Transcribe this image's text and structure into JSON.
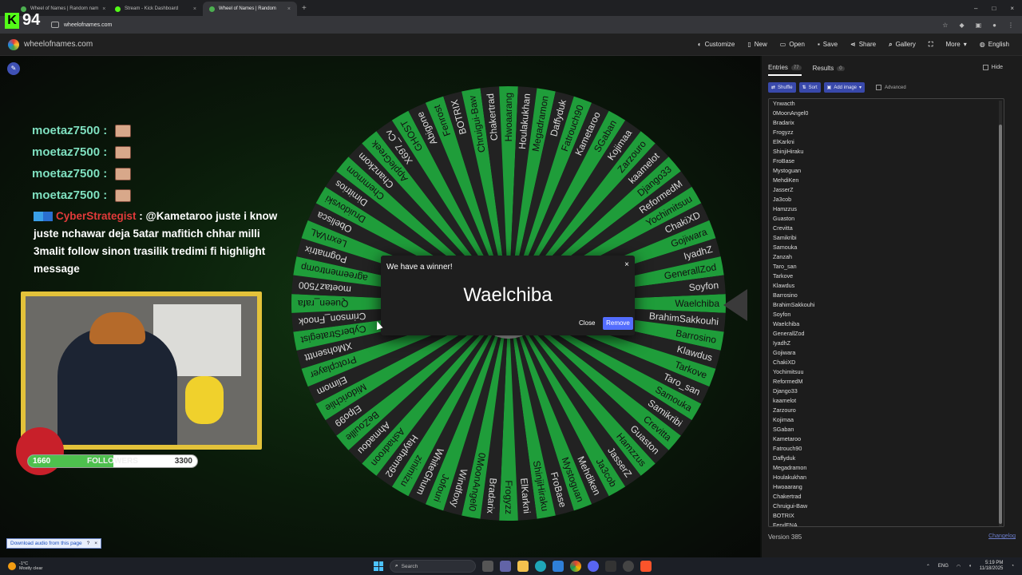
{
  "browser": {
    "tabs": [
      {
        "title": "Wheel of Names | Random nam",
        "color": "#4caf50",
        "active": false
      },
      {
        "title": "Stream - Kick Dashboard",
        "color": "#53fc18",
        "active": false
      },
      {
        "title": "Wheel of Names | Random",
        "color": "#4caf50",
        "active": true
      }
    ],
    "url": "wheelofnames.com"
  },
  "kick": {
    "logo": "K",
    "count": "94"
  },
  "app": {
    "site_name": "wheelofnames.com",
    "menu": [
      {
        "label": "Customize",
        "icon": "palette-icon"
      },
      {
        "label": "New",
        "icon": "file-icon"
      },
      {
        "label": "Open",
        "icon": "folder-icon"
      },
      {
        "label": "Save",
        "icon": "save-icon"
      },
      {
        "label": "Share",
        "icon": "share-icon"
      },
      {
        "label": "Gallery",
        "icon": "search-icon"
      },
      {
        "label": "",
        "icon": "fullscreen-icon"
      },
      {
        "label": "More",
        "icon": "chevron-down-icon"
      },
      {
        "label": "English",
        "icon": "globe-icon"
      }
    ]
  },
  "overlay": {
    "chat_lines": [
      "moetaz7500 :",
      "moetaz7500 :",
      "moetaz7500 :",
      "moetaz7500 :"
    ],
    "message_user": "CyberStrategist",
    "message_text": " : @Kametaroo juste i know juste nchawar deja 5atar mafitich chhar milli 3malit follow sinon trasilik tredimi fi highlight message",
    "followers": {
      "current": "1660",
      "label": "FOLLOWERS",
      "goal": "3300",
      "progress": 0.503
    }
  },
  "download_bar": {
    "label": "Download audio from this page",
    "help": "?",
    "close": "×"
  },
  "wheel": {
    "colors": [
      "#1f9d3a",
      "#222222"
    ],
    "names": [
      "Waelchiba",
      "BrahimSakkouhi",
      "Barrosino",
      "Klawdus",
      "Tarkove",
      "Taro_san",
      "Samouka",
      "Samikribi",
      "Crevitta",
      "Guaston",
      "Hamzzus",
      "JasserZ",
      "Ja3cob",
      "Mehdiken",
      "Mystoguan",
      "FroBase",
      "ShinjiHiraku",
      "ElKarkni",
      "Frogyzz",
      "Bradarix",
      "0MoonAngel0",
      "Windfoxy",
      "Jofouri",
      "WhiteGhum",
      "zinimizu",
      "Haythem92",
      "Ashadroon",
      "Ahmadou",
      "BeZouille",
      "Elpo99",
      "Midorichlie",
      "Elimom",
      "Protcplayer",
      "XMohsenttt",
      "CyberStrategist",
      "Crimson_Fnook",
      "Queen_rafa",
      "moetaz7500",
      "agreementromp",
      "Pogmatrix",
      "LexnVAL",
      "Obelisca",
      "Druidovski",
      "Dimitrios",
      "Chemmom",
      "Chanzkom",
      "AppleGreek",
      "X697_Cv",
      "GHOST",
      "Abigone",
      "Fenrost",
      "BOTRIX",
      "Chruigui-Baw",
      "Chakertrad",
      "Hwoaarang",
      "Houlakukhan",
      "Megadramon",
      "Daffyduk",
      "Fatrouch90",
      "Kametaroo",
      "SGaban",
      "Kojimaa",
      "Zarzouro",
      "kaamelot",
      "Django33",
      "ReformedM",
      "Yochimitsuu",
      "ChakiXD",
      "Gojiwara",
      "IyadhZ",
      "GenerallZod",
      "Soyfon"
    ],
    "winner_index": 0
  },
  "dialog": {
    "title": "We have a winner!",
    "close_x": "×",
    "winner": "Waelchiba",
    "close_label": "Close",
    "remove_label": "Remove",
    "accent": "#536dfe"
  },
  "panel": {
    "tabs": [
      {
        "label": "Entries",
        "count": "77"
      },
      {
        "label": "Results",
        "count": "0"
      }
    ],
    "hide_label": "Hide",
    "tools": {
      "shuffle": "Shuffle",
      "sort": "Sort",
      "add_image": "Add image",
      "advanced": "Advanced"
    },
    "entries": [
      "Ynwacth",
      "0MoonAngel0",
      "Bradarix",
      "Frogyzz",
      "ElKarkni",
      "ShinjiHiraku",
      "FroBase",
      "Mystoguan",
      "MehdiKen",
      "JasserZ",
      "Ja3cob",
      "Hamzzus",
      "Guaston",
      "Crevitta",
      "Samikribi",
      "Samouka",
      "Zanzah",
      "Taro_san",
      "Tarkove",
      "Klawdus",
      "Barrosino",
      "BrahimSakkouhi",
      "Soyfon",
      "Waelchiba",
      "GenerallZod",
      "IyadhZ",
      "Gojiwara",
      "ChakiXD",
      "Yochimitsuu",
      "ReformedM",
      "Django33",
      "kaamelot",
      "Zarzouro",
      "Kojimaa",
      "SGaban",
      "Kametaroo",
      "Fatrouch90",
      "Daffyduk",
      "Megadramon",
      "Houlakukhan",
      "Hwoaarang",
      "Chakertrad",
      "Chruigui-Baw",
      "BOTRIX",
      "FerylENA"
    ],
    "version": "Version 385",
    "changelog": "Changelog"
  },
  "taskbar": {
    "temperature": "-1°C",
    "weather": "Mostly clear",
    "search_placeholder": "Search",
    "lang": "ENG",
    "time": "5:19 PM",
    "date": "11/18/2025"
  }
}
